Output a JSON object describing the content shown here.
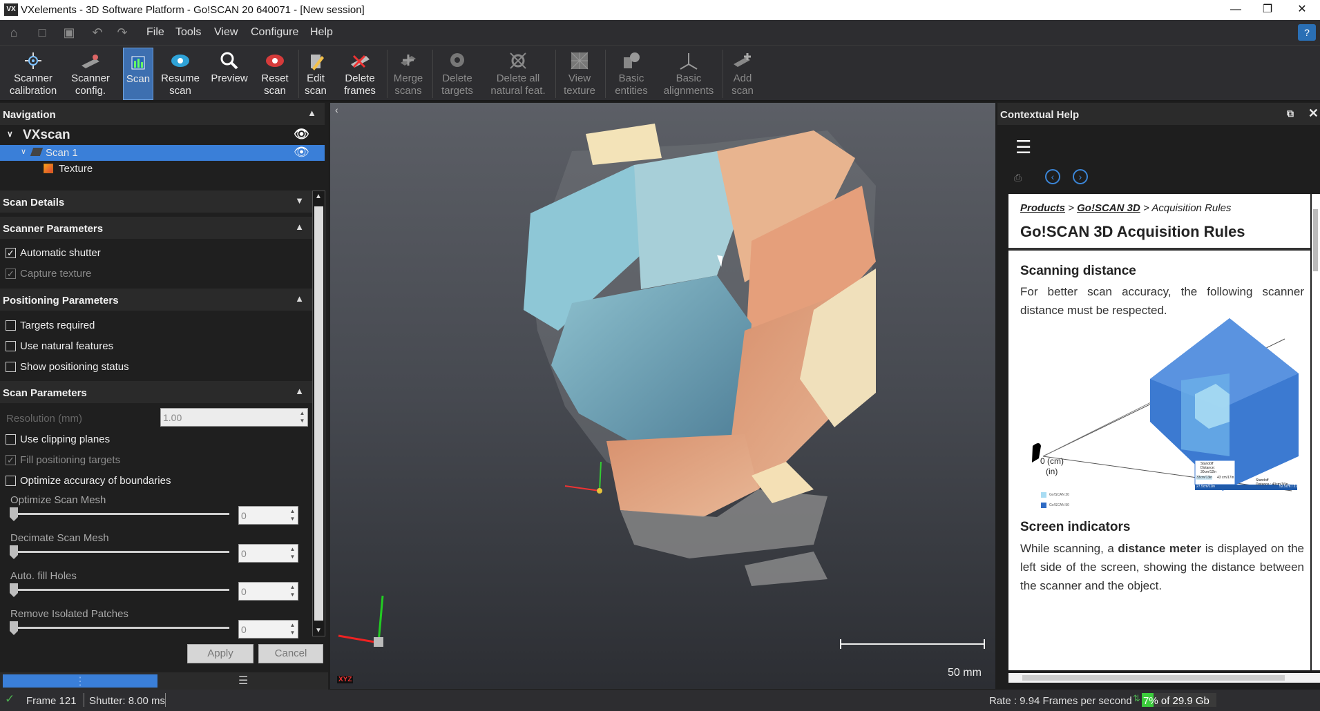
{
  "titlebar": {
    "app_icon": "VX",
    "title": "VXelements - 3D Software Platform - Go!SCAN 20 640071 - [New session]"
  },
  "menubar": {
    "items": [
      "File",
      "Tools",
      "View",
      "Configure",
      "Help"
    ],
    "help_icon": "?"
  },
  "ribbon": {
    "buttons": [
      {
        "label1": "Scanner",
        "label2": "calibration",
        "icon": "calibration-icon"
      },
      {
        "label1": "Scanner",
        "label2": "config.",
        "icon": "scanner-icon"
      },
      {
        "label1": "Scan",
        "label2": "",
        "icon": "scan-icon"
      },
      {
        "label1": "Resume",
        "label2": "scan",
        "icon": "resume-scan-icon"
      },
      {
        "label1": "Preview",
        "label2": "",
        "icon": "preview-icon"
      },
      {
        "label1": "Reset",
        "label2": "scan",
        "icon": "reset-scan-icon"
      },
      {
        "label1": "Edit",
        "label2": "scan",
        "icon": "edit-scan-icon"
      },
      {
        "label1": "Delete",
        "label2": "frames",
        "icon": "delete-frames-icon"
      },
      {
        "label1": "Merge",
        "label2": "scans",
        "icon": "merge-scans-icon"
      },
      {
        "label1": "Delete",
        "label2": "targets",
        "icon": "delete-targets-icon"
      },
      {
        "label1": "Delete all",
        "label2": "natural feat.",
        "icon": "delete-natural-features-icon"
      },
      {
        "label1": "View",
        "label2": "texture",
        "icon": "view-texture-icon"
      },
      {
        "label1": "Basic",
        "label2": "entities",
        "icon": "basic-entities-icon"
      },
      {
        "label1": "Basic",
        "label2": "alignments",
        "icon": "basic-alignments-icon"
      },
      {
        "label1": "Add",
        "label2": "scan",
        "icon": "add-scan-icon"
      }
    ]
  },
  "navigation": {
    "title": "Navigation",
    "root": "VXscan",
    "scan": "Scan 1",
    "texture": "Texture"
  },
  "scan_details": {
    "title": "Scan Details"
  },
  "scanner_params": {
    "title": "Scanner Parameters",
    "automatic_shutter": "Automatic shutter",
    "capture_texture": "Capture texture"
  },
  "positioning_params": {
    "title": "Positioning Parameters",
    "targets_required": "Targets required",
    "use_natural_features": "Use natural features",
    "show_positioning_status": "Show positioning status"
  },
  "scan_params": {
    "title": "Scan Parameters",
    "resolution_label": "Resolution (mm)",
    "resolution_value": "1.00",
    "use_clipping_planes": "Use clipping planes",
    "fill_positioning_targets": "Fill positioning targets",
    "optimize_accuracy": "Optimize accuracy of boundaries",
    "optimize_mesh_label": "Optimize Scan Mesh",
    "optimize_mesh_value": "0",
    "decimate_label": "Decimate Scan Mesh",
    "decimate_value": "0",
    "fill_holes_label": "Auto. fill Holes",
    "fill_holes_value": "0",
    "remove_patches_label": "Remove Isolated Patches",
    "remove_patches_value": "0"
  },
  "actions": {
    "apply": "Apply",
    "cancel": "Cancel"
  },
  "viewport": {
    "scale_label": "50 mm",
    "axis_label": "XYZ"
  },
  "help": {
    "title": "Contextual Help",
    "crumb_products": "Products",
    "crumb_sep": ">",
    "crumb_goscan": "Go!SCAN 3D",
    "crumb_current": "Acquisition Rules",
    "heading": "Go!SCAN 3D Acquisition Rules",
    "section1": "Scanning distance",
    "para1": "For better scan accuracy, the following scanner distance must be respected.",
    "fig_zero_cm": "0 (cm)",
    "fig_zero_in": "(in)",
    "fig_standoff": "Standoff",
    "fig_standoff_distance": "Distance:",
    "fig_standoff_val": "30cm/12in",
    "fig_depth1": "33cm/13in",
    "fig_depth2": "43 cm/17in",
    "fig_standoff2": "Standoff",
    "fig_standoff2_distance": "Distance : 40cm/16in",
    "fig_bottom1": "27.5cm/11in",
    "fig_bottom2": "52.5cm / 21 in",
    "fig_legend1": "Go!SCAN 20",
    "fig_legend2": "Go!SCAN 50",
    "section2": "Screen indicators",
    "para2_a": "While scanning, a ",
    "para2_b": "distance meter",
    "para2_c": " is displayed on the left side of the screen, showing the distance between the scanner and the object."
  },
  "status": {
    "frame": "Frame 121",
    "shutter": "Shutter: 8.00 ms",
    "rate": "Rate : 9.94 Frames per second",
    "memory": "7% of 29.9 Gb",
    "memory_fraction": 0.07
  }
}
